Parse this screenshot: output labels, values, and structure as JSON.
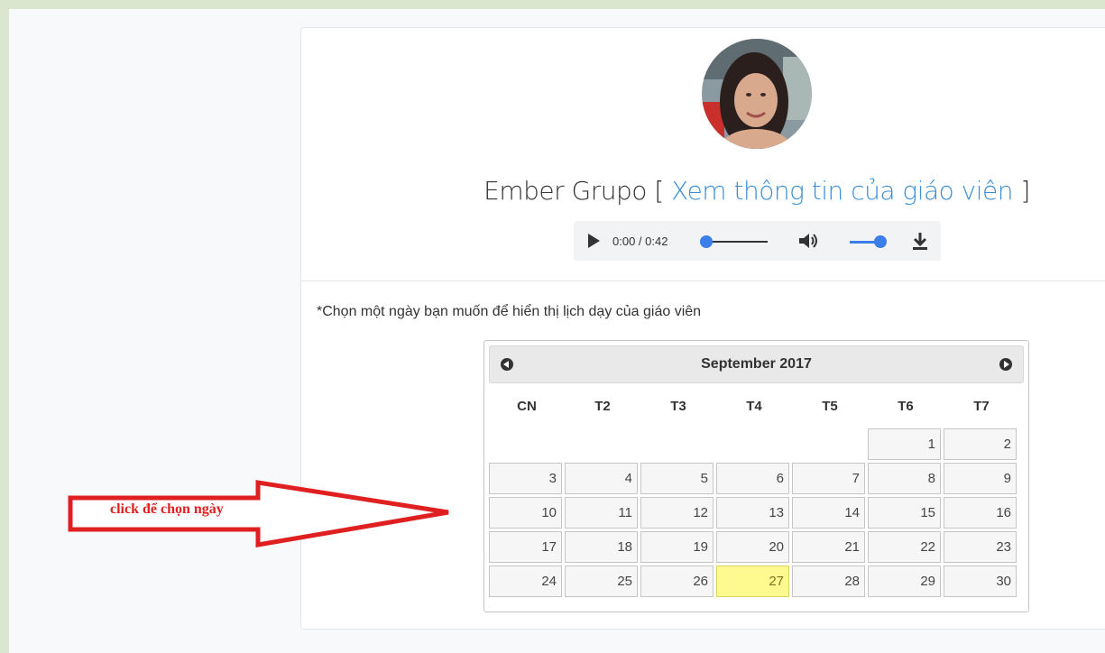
{
  "teacher": {
    "name": "Ember Grupo",
    "bracket_open": " [ ",
    "profile_link": "Xem thông tin của giáo viên",
    "bracket_close": " ]"
  },
  "audio": {
    "time": "0:00 / 0:42",
    "play_icon": "play-icon",
    "volume_icon": "volume-icon",
    "download_icon": "download-icon",
    "accent_color": "#3b7de9"
  },
  "instruction": "*Chọn một ngày bạn muốn để hiển thị lịch dạy của giáo viên",
  "calendar": {
    "title": "September 2017",
    "prev_icon": "circle-triangle-left-icon",
    "next_icon": "circle-triangle-right-icon",
    "weekdays": [
      "CN",
      "T2",
      "T3",
      "T4",
      "T5",
      "T6",
      "T7"
    ],
    "weeks": [
      [
        "",
        "",
        "",
        "",
        "",
        "1",
        "2"
      ],
      [
        "3",
        "4",
        "5",
        "6",
        "7",
        "8",
        "9"
      ],
      [
        "10",
        "11",
        "12",
        "13",
        "14",
        "15",
        "16"
      ],
      [
        "17",
        "18",
        "19",
        "20",
        "21",
        "22",
        "23"
      ],
      [
        "24",
        "25",
        "26",
        "27",
        "28",
        "29",
        "30"
      ]
    ],
    "highlighted_day": "27",
    "highlight_color": "#fffa90"
  },
  "annotation": {
    "text": "click để chọn ngày",
    "color": "#e02020"
  }
}
